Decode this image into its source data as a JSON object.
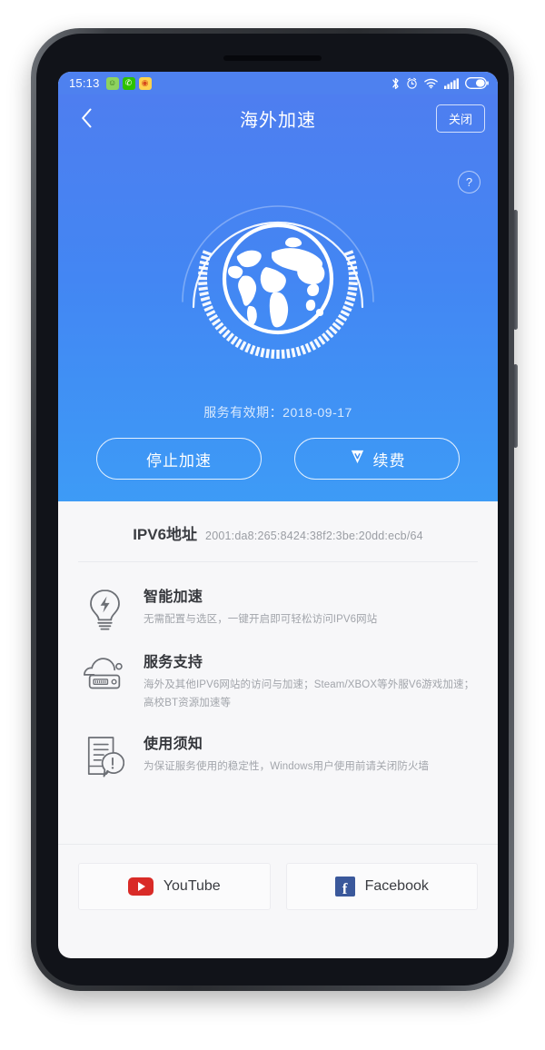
{
  "statusbar": {
    "time": "15:13",
    "apps": [
      {
        "name": "qq-icon",
        "glyph": "☺"
      },
      {
        "name": "wechat-icon",
        "glyph": "✆"
      },
      {
        "name": "weibo-icon",
        "glyph": "◉"
      }
    ],
    "icons": [
      "bluetooth-icon",
      "alarm-icon",
      "wifi-icon",
      "signal-icon",
      "battery-icon"
    ]
  },
  "nav": {
    "back": "‹",
    "title": "海外加速",
    "close_label": "关闭",
    "help_label": "?"
  },
  "hero": {
    "expiry_text": "服务有效期：2018-09-17",
    "stop_label": "停止加速",
    "renew_label": "续费",
    "accent": "#4386f3"
  },
  "ipv6": {
    "label": "IPV6地址",
    "value": "2001:da8:265:8424:38f2:3be:20dd:ecb/64"
  },
  "features": [
    {
      "icon": "lightbulb-icon",
      "title": "智能加速",
      "desc": "无需配置与选区，一键开启即可轻松访问IPV6网站"
    },
    {
      "icon": "cloud-server-icon",
      "title": "服务支持",
      "desc": "海外及其他IPV6网站的访问与加速；Steam/XBOX等外服V6游戏加速；高校BT资源加速等"
    },
    {
      "icon": "document-alert-icon",
      "title": "使用须知",
      "desc": "为保证服务使用的稳定性，Windows用户使用前请关闭防火墙"
    }
  ],
  "social": [
    {
      "icon": "youtube-icon",
      "label": "YouTube",
      "color": "#d92b27"
    },
    {
      "icon": "facebook-icon",
      "label": "Facebook",
      "color": "#3a589b",
      "glyph": "f"
    }
  ]
}
